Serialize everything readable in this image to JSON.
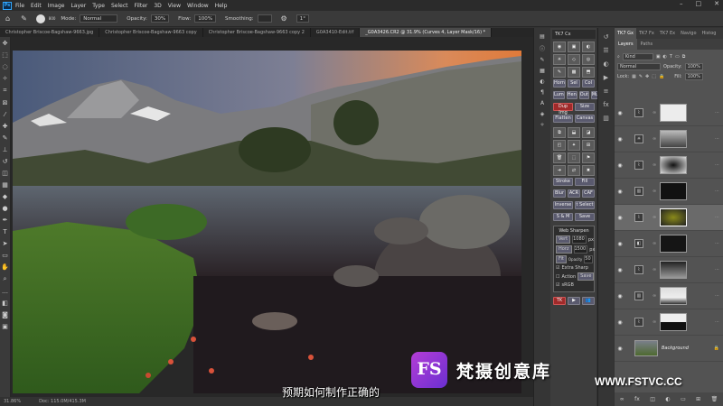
{
  "menubar": {
    "logo": "Ps",
    "items": [
      "File",
      "Edit",
      "Image",
      "Layer",
      "Type",
      "Select",
      "Filter",
      "3D",
      "View",
      "Window",
      "Help"
    ]
  },
  "options": {
    "mode_label": "Mode:",
    "mode_value": "Normal",
    "opacity_label": "Opacity:",
    "opacity_value": "30%",
    "flow_label": "Flow:",
    "flow_value": "100%",
    "smoothing_label": "Smoothing:",
    "angle_value": "1°",
    "brush_size": "800"
  },
  "tabs": [
    {
      "label": "Christopher Briscoe-Bagshaw-9663.jpg"
    },
    {
      "label": "Christopher Briscoe-Bagshaw-9663 copy"
    },
    {
      "label": "Christopher Briscoe-Bagshaw-9663 copy 2"
    },
    {
      "label": "G0A3410-Edit.tif"
    },
    {
      "label": "_G0A3426.CR2 @ 31.9% (Curves 4, Layer Mask/16) *"
    }
  ],
  "status": {
    "zoom": "31.86%",
    "doc": "Doc: 115.0M/415.3M"
  },
  "tk7": {
    "title": "TK7 Cx",
    "row_buttons": [
      [
        "Horn",
        "Sel",
        "Col"
      ],
      [
        "Lum",
        "Hen",
        "Out",
        "Mul"
      ]
    ],
    "buttons": [
      "Dup Img",
      "Size",
      "Flatten",
      "Canvas"
    ],
    "stroke_fill": [
      "Stroke",
      "Fill"
    ],
    "blr_acr_caf": [
      "Blur",
      "ACR",
      "CAF"
    ],
    "inverse_select": [
      "Inverse",
      "t Select"
    ],
    "sm_save": [
      "S & M",
      "Save"
    ],
    "web_sharpen": {
      "title": "Web Sharpen",
      "vert_label": "Vert",
      "vert_value": "1080",
      "horz_label": "Horz",
      "horz_value": "1500",
      "unit": "px",
      "opacity_label": "Opacity",
      "fit_label": "Fit",
      "fit_value": "50",
      "extra_sharp": "Extra Sharp",
      "action_label": "Action",
      "save_label": "Save",
      "srgb_label": "sRGB"
    },
    "footer": "TK"
  },
  "layers_panel": {
    "top_tabs": [
      "TK7 Gx",
      "TK7 Fx",
      "TK7 Ex",
      "Navigo",
      "Histog"
    ],
    "tabs": [
      "Layers",
      "Paths"
    ],
    "kind_label": "Kind",
    "blend_mode": "Normal",
    "opacity_label": "Opacity:",
    "opacity_value": "100%",
    "lock_label": "Lock:",
    "fill_label": "Fill:",
    "fill_value": "100%",
    "background_name": "Background"
  },
  "subtitle": "预期如何制作正确的",
  "watermark": {
    "logo": "FS",
    "text": "梵摄创意库",
    "url": "WWW.FSTVC.CC"
  }
}
